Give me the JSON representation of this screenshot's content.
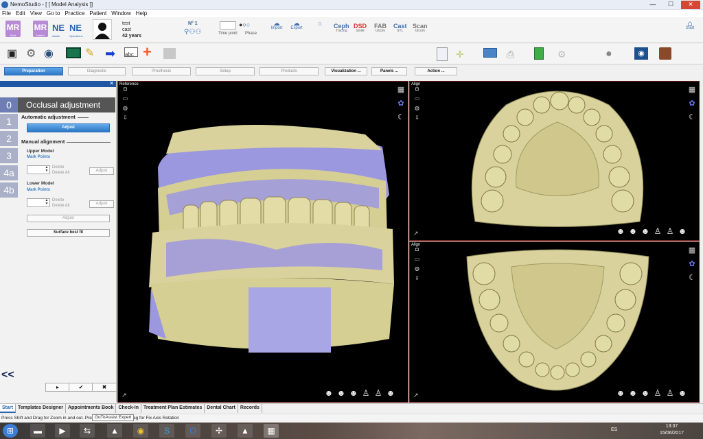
{
  "window": {
    "title": "NemoStudio - [ [ Model Analysis ]]",
    "controls": [
      "—",
      "☐",
      "✕"
    ]
  },
  "menu": [
    "File",
    "Edit",
    "View",
    "Go to",
    "Practice",
    "Patient",
    "Window",
    "Help"
  ],
  "top_toolbar": {
    "mr_tile": {
      "label": "MR",
      "sub": "Start"
    },
    "mr_tile2": {
      "label": "MR",
      "sub": "Master"
    },
    "ne1": {
      "label": "NE",
      "sub": "Assist."
    },
    "ne2": {
      "label": "NE",
      "sub": "Operations"
    },
    "patient": {
      "first": "test",
      "last": "cast",
      "age": "42 years"
    },
    "record_no": "N° 1",
    "time_point_label": "Time point",
    "phase_label": "Phase",
    "import_label": "Import",
    "export_label": "Export",
    "ceph": {
      "label": "Ceph",
      "sub": "Tracing"
    },
    "dsd": {
      "label": "DSD",
      "sub": "Smile"
    },
    "fab": {
      "label": "FAB",
      "sub": "Ulcom"
    },
    "cast": {
      "label": "Cast",
      "sub": "STL"
    },
    "scan": {
      "label": "Scan",
      "sub": "Ulcom"
    },
    "home_label": "Start"
  },
  "process_tabs": [
    {
      "label": "Preparation",
      "active": true
    },
    {
      "label": "Diagnostic"
    },
    {
      "label": "Prosthesis"
    },
    {
      "label": "Setup"
    },
    {
      "label": "Products"
    },
    {
      "label": "Visualization ..."
    },
    {
      "label": "Panels ..."
    },
    {
      "label": "Action ..."
    }
  ],
  "left_panel": {
    "steps": [
      "0",
      "1",
      "2",
      "3",
      "4a",
      "4b"
    ],
    "title": "Occlusal adjustment",
    "automatic_section": "Automatic adjustment",
    "adjust_btn": "Adjust",
    "manual_section": "Manual alignment",
    "upper_model": "Upper Model",
    "lower_model": "Lower Model",
    "mark_points": "Mark Points",
    "delete": "Delete",
    "delete_all": "Delete All",
    "adjust_small": "Adjust",
    "adjust_wide": "Adjust",
    "surface_fit": "Surface best fit",
    "back": "<<",
    "nav": [
      "▸",
      "✔",
      "✖"
    ]
  },
  "viewports": {
    "main_label": "Reference",
    "top_right_label": "Align",
    "bottom_right_label": "Align"
  },
  "bottom_tabs": [
    "Start",
    "Templates Designer",
    "Appointments Book",
    "Check-In",
    "Treatment Plan Estimates",
    "Dental Chart",
    "Records"
  ],
  "status": "Press Shift and Drag for Zoom in and out. Press Ctrl + Shift and Drag for Fix Axis Rotation",
  "tooltip": "GoToAssist Expert",
  "taskbar": {
    "lang": "ES",
    "time": "13:37",
    "date": "15/06/2017"
  },
  "colors": {
    "accent": "#2a6fba",
    "viewport_border": "#6a1515",
    "model_yellow": "#dcd59a",
    "model_lilac": "#9b98e0"
  }
}
